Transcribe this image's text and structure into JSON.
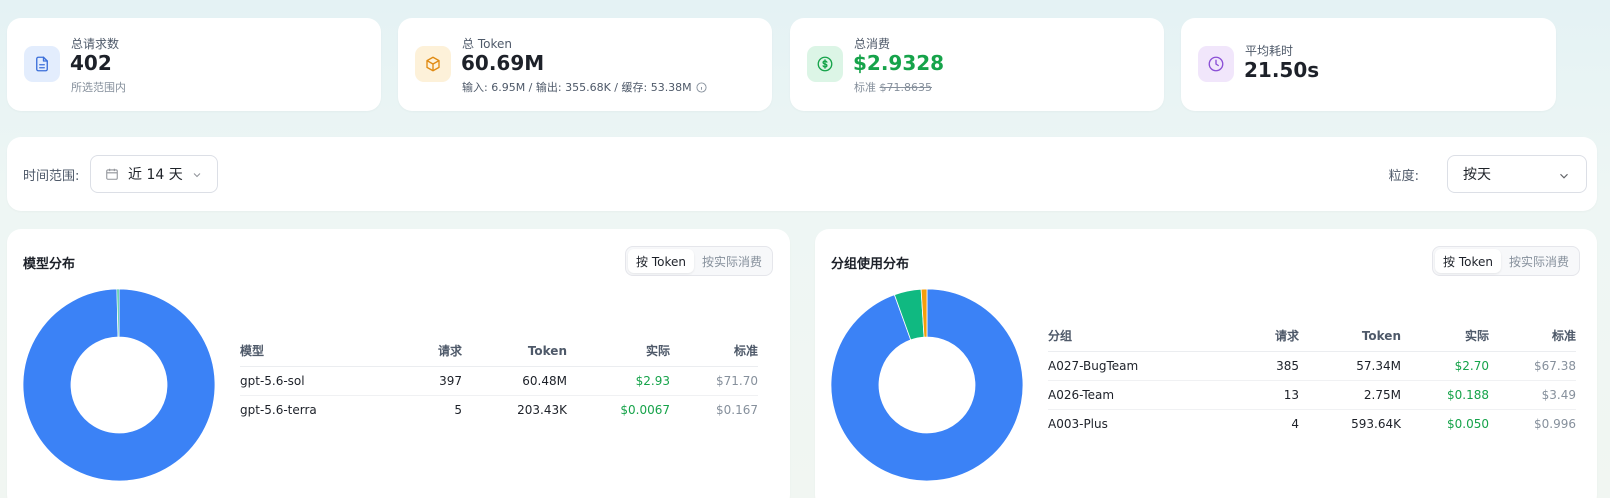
{
  "stats": [
    {
      "label": "总请求数",
      "value": "402",
      "sub": "所选范围内",
      "icon": "document-icon",
      "color": "#3b6fd9",
      "bg": "#e3edfd"
    },
    {
      "label": "总 Token",
      "value": "60.69M",
      "sub": "输入: 6.95M / 输出: 355.68K / 缓存: 53.38M",
      "icon": "cube-icon",
      "color": "#e08a12",
      "bg": "#fdf1d9"
    },
    {
      "label": "总消费",
      "value": "$2.9328",
      "sub_prefix": "标准",
      "sub_strike": "$71.8635",
      "icon": "dollar-icon",
      "color": "#16a34a",
      "bg": "#dcf5e6"
    },
    {
      "label": "平均耗时",
      "value": "21.50s",
      "icon": "clock-icon",
      "color": "#8b4fd6",
      "bg": "#f1e6fb"
    }
  ],
  "filter": {
    "range_label": "时间范围:",
    "range_value": "近 14 天",
    "granularity_label": "粒度:",
    "granularity_value": "按天"
  },
  "model_panel": {
    "title": "模型分布",
    "toggle": [
      "按 Token",
      "按实际消费"
    ],
    "active_toggle": 0,
    "columns": [
      "模型",
      "请求",
      "Token",
      "实际",
      "标准"
    ],
    "rows": [
      {
        "name": "gpt-5.6-sol",
        "requests": "397",
        "token": "60.48M",
        "actual": "$2.93",
        "standard": "$71.70"
      },
      {
        "name": "gpt-5.6-terra",
        "requests": "5",
        "token": "203.43K",
        "actual": "$0.0067",
        "standard": "$0.167"
      }
    ],
    "chart_data": {
      "type": "pie",
      "categories": [
        "gpt-5.6-sol",
        "gpt-5.6-terra"
      ],
      "values": [
        60.48,
        0.20343
      ],
      "colors": [
        "#3b82f6",
        "#10b981"
      ]
    }
  },
  "group_panel": {
    "title": "分组使用分布",
    "toggle": [
      "按 Token",
      "按实际消费"
    ],
    "active_toggle": 0,
    "columns": [
      "分组",
      "请求",
      "Token",
      "实际",
      "标准"
    ],
    "rows": [
      {
        "name": "A027-BugTeam",
        "requests": "385",
        "token": "57.34M",
        "actual": "$2.70",
        "standard": "$67.38"
      },
      {
        "name": "A026-Team",
        "requests": "13",
        "token": "2.75M",
        "actual": "$0.188",
        "standard": "$3.49"
      },
      {
        "name": "A003-Plus",
        "requests": "4",
        "token": "593.64K",
        "actual": "$0.050",
        "standard": "$0.996"
      }
    ],
    "chart_data": {
      "type": "pie",
      "categories": [
        "A027-BugTeam",
        "A026-Team",
        "A003-Plus"
      ],
      "values": [
        57.34,
        2.75,
        0.59364
      ],
      "colors": [
        "#3b82f6",
        "#10b981",
        "#f59e0b"
      ]
    }
  }
}
